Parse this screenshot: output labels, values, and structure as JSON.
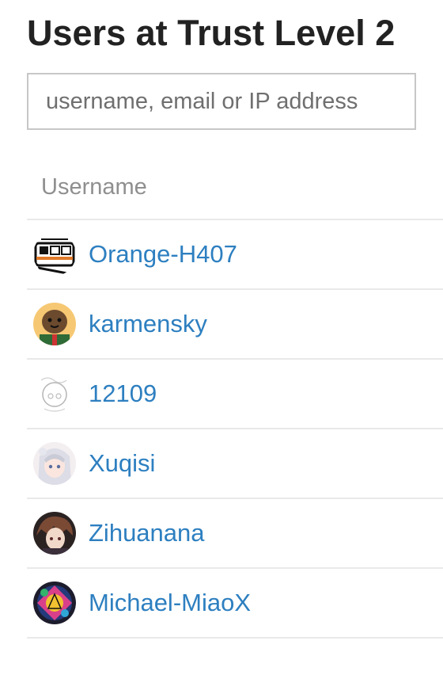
{
  "page": {
    "title": "Users at Trust Level 2"
  },
  "search": {
    "placeholder": "username, email or IP address",
    "value": ""
  },
  "table": {
    "columns": [
      "Username"
    ],
    "rows": [
      {
        "username": "Orange-H407",
        "avatar": "train-avatar"
      },
      {
        "username": "karmensky",
        "avatar": "cartoon-face-avatar"
      },
      {
        "username": "12109",
        "avatar": "sketch-avatar"
      },
      {
        "username": "Xuqisi",
        "avatar": "anime-girl-avatar"
      },
      {
        "username": "Zihuanana",
        "avatar": "anime-boy-avatar"
      },
      {
        "username": "Michael-MiaoX",
        "avatar": "colorful-art-avatar"
      }
    ]
  }
}
